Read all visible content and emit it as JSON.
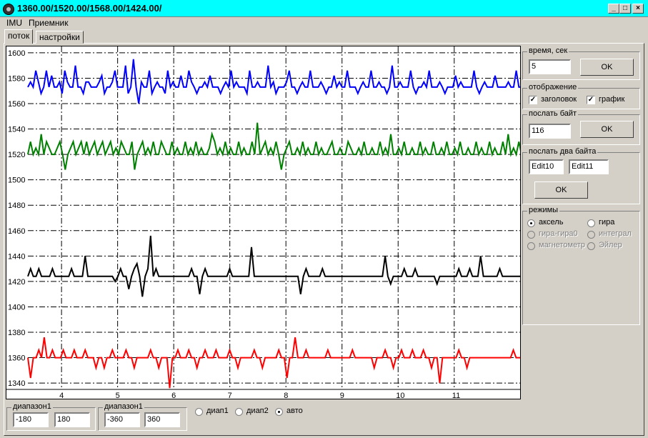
{
  "window": {
    "title": "1360.00/1520.00/1568.00/1424.00/"
  },
  "menu": [
    "IMU",
    "Приемник"
  ],
  "tabs": [
    "поток",
    "настройки"
  ],
  "settings": {
    "time_label": "время, сек",
    "time_value": "5",
    "ok": "OK",
    "display_label": "отображение",
    "show_title": "заголовок",
    "show_chart": "график",
    "send_byte_label": "послать байт",
    "send_byte_value": "116",
    "send_two_label": "послать два байта",
    "edit10": "Edit10",
    "edit11": "Edit11",
    "modes_label": "режимы",
    "modes": [
      "аксель",
      "гира",
      "гира-гира0",
      "интеграл",
      "магнетометр",
      "Эйлер"
    ]
  },
  "bottom": {
    "range1_label": "диапазон1",
    "range1_min": "-180",
    "range1_max": "180",
    "range2_label": "диапазон1",
    "range2_min": "-360",
    "range2_max": "360",
    "radio_range1": "диап1",
    "radio_range2": "диап2",
    "radio_auto": "авто"
  },
  "chart_data": {
    "type": "line",
    "ylim": [
      1335,
      1605
    ],
    "xlim": [
      3.4,
      12.2
    ],
    "y_ticks": [
      1600,
      1580,
      1560,
      1540,
      1520,
      1500,
      1480,
      1460,
      1440,
      1420,
      1400,
      1380,
      1360,
      1340
    ],
    "x_ticks": [
      4,
      5,
      6,
      7,
      8,
      9,
      10,
      11
    ],
    "grid": true,
    "colors": [
      "#0000ff",
      "#008000",
      "#000000",
      "#ff0000"
    ],
    "series": [
      {
        "values": [
          1573,
          1577,
          1573,
          1586,
          1577,
          1568,
          1573,
          1586,
          1573,
          1582,
          1573,
          1573,
          1577,
          1568,
          1586,
          1577,
          1573,
          1573,
          1590,
          1573,
          1573,
          1568,
          1577,
          1577,
          1573,
          1573,
          1573,
          1577,
          1582,
          1568,
          1573,
          1573,
          1577,
          1586,
          1573,
          1573,
          1573,
          1590,
          1568,
          1573,
          1595,
          1573,
          1560,
          1577,
          1573,
          1573,
          1586,
          1568,
          1573,
          1577,
          1573,
          1573,
          1568,
          1586,
          1573,
          1577,
          1573,
          1573,
          1582,
          1573,
          1573,
          1586,
          1577,
          1573,
          1568,
          1573,
          1573,
          1577,
          1573,
          1582,
          1573,
          1573,
          1573,
          1568,
          1573,
          1577,
          1573,
          1586,
          1573,
          1577,
          1573,
          1573,
          1573,
          1568,
          1586,
          1573,
          1573,
          1577,
          1573,
          1573,
          1573,
          1590,
          1573,
          1577,
          1568,
          1573,
          1573,
          1573,
          1577,
          1586,
          1573,
          1573,
          1568,
          1573,
          1577,
          1573,
          1573,
          1586,
          1573,
          1573,
          1573,
          1577,
          1573,
          1568,
          1573,
          1573,
          1582,
          1573,
          1577,
          1573,
          1573,
          1586,
          1573,
          1573,
          1573,
          1568,
          1573,
          1577,
          1573,
          1573,
          1586,
          1573,
          1573,
          1577,
          1573,
          1573,
          1568,
          1573,
          1590,
          1573,
          1573,
          1577,
          1573,
          1573,
          1573,
          1586,
          1573,
          1568,
          1573,
          1573,
          1577,
          1573,
          1586,
          1573,
          1573,
          1573,
          1577,
          1573,
          1568,
          1573,
          1573,
          1573,
          1582,
          1573,
          1577,
          1573,
          1573,
          1573,
          1573,
          1586,
          1573,
          1568,
          1573,
          1577,
          1573,
          1573,
          1573,
          1582,
          1573,
          1573,
          1573,
          1573,
          1577,
          1573,
          1573,
          1586,
          1573,
          1573
        ]
      },
      {
        "values": [
          1520,
          1530,
          1520,
          1525,
          1520,
          1536,
          1520,
          1530,
          1525,
          1520,
          1520,
          1525,
          1530,
          1520,
          1508,
          1520,
          1525,
          1530,
          1520,
          1525,
          1530,
          1520,
          1530,
          1520,
          1525,
          1530,
          1520,
          1525,
          1530,
          1520,
          1525,
          1530,
          1520,
          1525,
          1520,
          1530,
          1525,
          1520,
          1520,
          1530,
          1508,
          1520,
          1525,
          1530,
          1520,
          1525,
          1520,
          1530,
          1520,
          1520,
          1530,
          1525,
          1520,
          1520,
          1530,
          1520,
          1525,
          1520,
          1520,
          1530,
          1520,
          1525,
          1520,
          1530,
          1520,
          1525,
          1520,
          1520,
          1525,
          1536,
          1530,
          1520,
          1525,
          1520,
          1530,
          1520,
          1525,
          1520,
          1520,
          1530,
          1520,
          1525,
          1520,
          1520,
          1530,
          1520,
          1545,
          1520,
          1525,
          1530,
          1520,
          1525,
          1520,
          1530,
          1520,
          1508,
          1520,
          1525,
          1530,
          1520,
          1520,
          1525,
          1520,
          1530,
          1520,
          1525,
          1520,
          1520,
          1530,
          1520,
          1525,
          1520,
          1520,
          1525,
          1530,
          1520,
          1520,
          1525,
          1520,
          1520,
          1530,
          1525,
          1520,
          1520,
          1525,
          1520,
          1530,
          1520,
          1520,
          1525,
          1520,
          1520,
          1530,
          1520,
          1525,
          1520,
          1536,
          1520,
          1520,
          1525,
          1520,
          1530,
          1520,
          1520,
          1525,
          1520,
          1520,
          1530,
          1520,
          1525,
          1520,
          1520,
          1530,
          1520,
          1520,
          1525,
          1520,
          1530,
          1520,
          1520,
          1525,
          1520,
          1530,
          1520,
          1520,
          1525,
          1520,
          1520,
          1530,
          1520,
          1525,
          1520,
          1520,
          1530,
          1520,
          1525,
          1520,
          1520,
          1530,
          1520,
          1536,
          1520,
          1525,
          1520,
          1530,
          1520
        ]
      },
      {
        "values": [
          1424,
          1430,
          1424,
          1424,
          1430,
          1424,
          1424,
          1424,
          1424,
          1430,
          1424,
          1424,
          1424,
          1424,
          1424,
          1424,
          1430,
          1424,
          1424,
          1424,
          1424,
          1440,
          1424,
          1424,
          1424,
          1424,
          1424,
          1424,
          1424,
          1424,
          1424,
          1424,
          1420,
          1424,
          1430,
          1424,
          1424,
          1414,
          1424,
          1430,
          1434,
          1424,
          1408,
          1424,
          1430,
          1456,
          1424,
          1430,
          1424,
          1424,
          1424,
          1424,
          1424,
          1424,
          1424,
          1424,
          1424,
          1424,
          1424,
          1424,
          1430,
          1424,
          1424,
          1410,
          1424,
          1430,
          1424,
          1424,
          1424,
          1424,
          1424,
          1424,
          1424,
          1424,
          1430,
          1424,
          1424,
          1424,
          1424,
          1424,
          1424,
          1424,
          1447,
          1424,
          1424,
          1424,
          1424,
          1424,
          1424,
          1424,
          1424,
          1424,
          1424,
          1424,
          1424,
          1424,
          1424,
          1424,
          1424,
          1424,
          1410,
          1424,
          1430,
          1424,
          1424,
          1424,
          1424,
          1424,
          1430,
          1424,
          1424,
          1424,
          1424,
          1424,
          1424,
          1424,
          1424,
          1424,
          1424,
          1424,
          1424,
          1424,
          1424,
          1424,
          1424,
          1424,
          1424,
          1424,
          1424,
          1424,
          1424,
          1440,
          1424,
          1418,
          1424,
          1424,
          1424,
          1424,
          1430,
          1424,
          1424,
          1424,
          1430,
          1424,
          1424,
          1424,
          1424,
          1424,
          1424,
          1424,
          1418,
          1424,
          1424,
          1424,
          1424,
          1424,
          1424,
          1424,
          1430,
          1424,
          1424,
          1424,
          1430,
          1424,
          1424,
          1424,
          1440,
          1424,
          1424,
          1424,
          1424,
          1424,
          1424,
          1430,
          1424,
          1424,
          1424,
          1424,
          1424,
          1424,
          1424,
          1424
        ]
      },
      {
        "values": [
          1360,
          1344,
          1360,
          1360,
          1366,
          1360,
          1376,
          1360,
          1360,
          1366,
          1360,
          1360,
          1360,
          1366,
          1360,
          1360,
          1360,
          1366,
          1360,
          1360,
          1360,
          1366,
          1360,
          1360,
          1360,
          1352,
          1360,
          1360,
          1352,
          1360,
          1360,
          1366,
          1360,
          1360,
          1360,
          1360,
          1366,
          1360,
          1360,
          1352,
          1360,
          1360,
          1360,
          1360,
          1360,
          1366,
          1360,
          1360,
          1352,
          1360,
          1360,
          1360,
          1336,
          1360,
          1360,
          1366,
          1360,
          1360,
          1360,
          1366,
          1360,
          1360,
          1352,
          1360,
          1360,
          1366,
          1360,
          1360,
          1360,
          1366,
          1360,
          1360,
          1360,
          1360,
          1366,
          1360,
          1360,
          1352,
          1360,
          1360,
          1360,
          1360,
          1360,
          1366,
          1360,
          1360,
          1352,
          1360,
          1360,
          1360,
          1360,
          1360,
          1366,
          1360,
          1360,
          1344,
          1360,
          1360,
          1376,
          1360,
          1360,
          1360,
          1366,
          1360,
          1360,
          1360,
          1360,
          1360,
          1360,
          1360,
          1366,
          1360,
          1360,
          1360,
          1360,
          1360,
          1360,
          1360,
          1360,
          1366,
          1360,
          1360,
          1360,
          1360,
          1360,
          1360,
          1360,
          1352,
          1360,
          1360,
          1360,
          1366,
          1360,
          1360,
          1352,
          1360,
          1360,
          1366,
          1360,
          1360,
          1360,
          1366,
          1360,
          1360,
          1360,
          1366,
          1360,
          1360,
          1352,
          1360,
          1360,
          1340,
          1360,
          1360,
          1360,
          1360,
          1360,
          1360,
          1366,
          1360,
          1360,
          1352,
          1360,
          1360,
          1360,
          1360,
          1360,
          1360,
          1360,
          1360,
          1360,
          1360,
          1360,
          1360,
          1360,
          1360,
          1360,
          1360,
          1366,
          1360,
          1360,
          1360
        ]
      }
    ]
  }
}
